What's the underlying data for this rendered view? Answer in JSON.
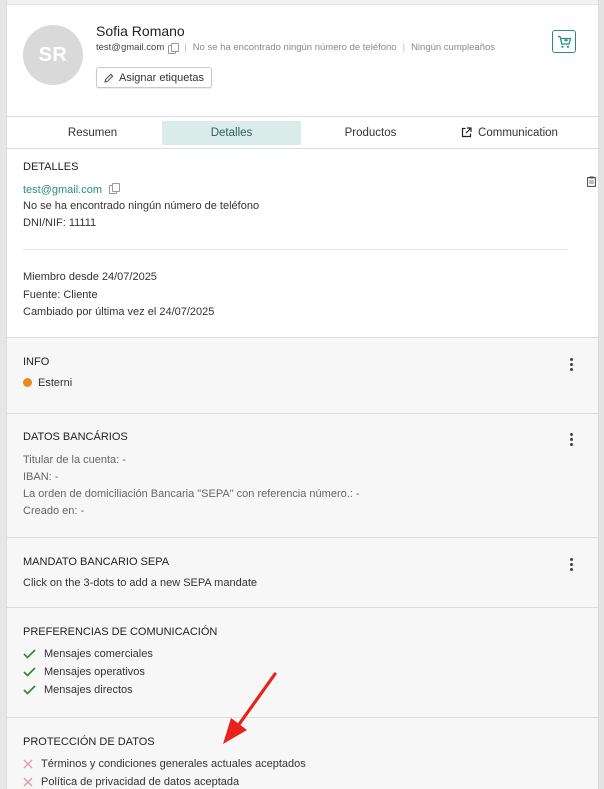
{
  "colors": {
    "accent": "#2a8c86",
    "tab_active_bg": "#d9ecea",
    "orange_dot": "#e88b1c",
    "arrow": "#e8221b",
    "check": "#2c8a2c",
    "cross": "#e89a9a"
  },
  "header": {
    "avatar_initials": "SR",
    "name": "Sofia Romano",
    "email": "test@gmail.com",
    "phone_status": "No se ha encontrado ningún número de teléfono",
    "birthday_status": "Ningún cumpleaños",
    "sep": "|",
    "assign_tags_label": "Asignar etiquetas",
    "cart_icon": "shopping-cart-icon"
  },
  "tabs": [
    {
      "label": "Resumen"
    },
    {
      "label": "Detalles"
    },
    {
      "label": "Productos"
    },
    {
      "label": "Communication",
      "icon": "external-link-icon"
    }
  ],
  "detalles": {
    "title": "DETALLES",
    "email": "test@gmail.com",
    "phone": "No se ha encontrado ningún número de teléfono",
    "dni": "DNI/NIF: 11111",
    "member_since": "Miembro desde 24/07/2025",
    "source": "Fuente: Cliente",
    "last_changed": "Cambiado por última vez el 24/07/2025"
  },
  "info": {
    "title": "INFO",
    "item": "Esterni"
  },
  "bancarios": {
    "title": "DATOS BANCÁRIOS",
    "titular": "Titular de la cuenta: -",
    "iban": "IBAN: -",
    "sepa_order": "La orden de domiciliación Bancaria \"SEPA\" con referencia número.: -",
    "created": "Creado en: -"
  },
  "mandato": {
    "title": "MANDATO BANCARIO SEPA",
    "hint": "Click on the 3-dots to add a new SEPA mandate"
  },
  "preferencias": {
    "title": "PREFERENCIAS DE COMUNICACIÓN",
    "items": [
      "Mensajes comerciales",
      "Mensajes operativos",
      "Mensajes directos"
    ]
  },
  "proteccion": {
    "title": "PROTECCIÓN DE DATOS",
    "items": [
      "Términos y condiciones generales actuales aceptados",
      "Política de privacidad de datos aceptada"
    ]
  }
}
